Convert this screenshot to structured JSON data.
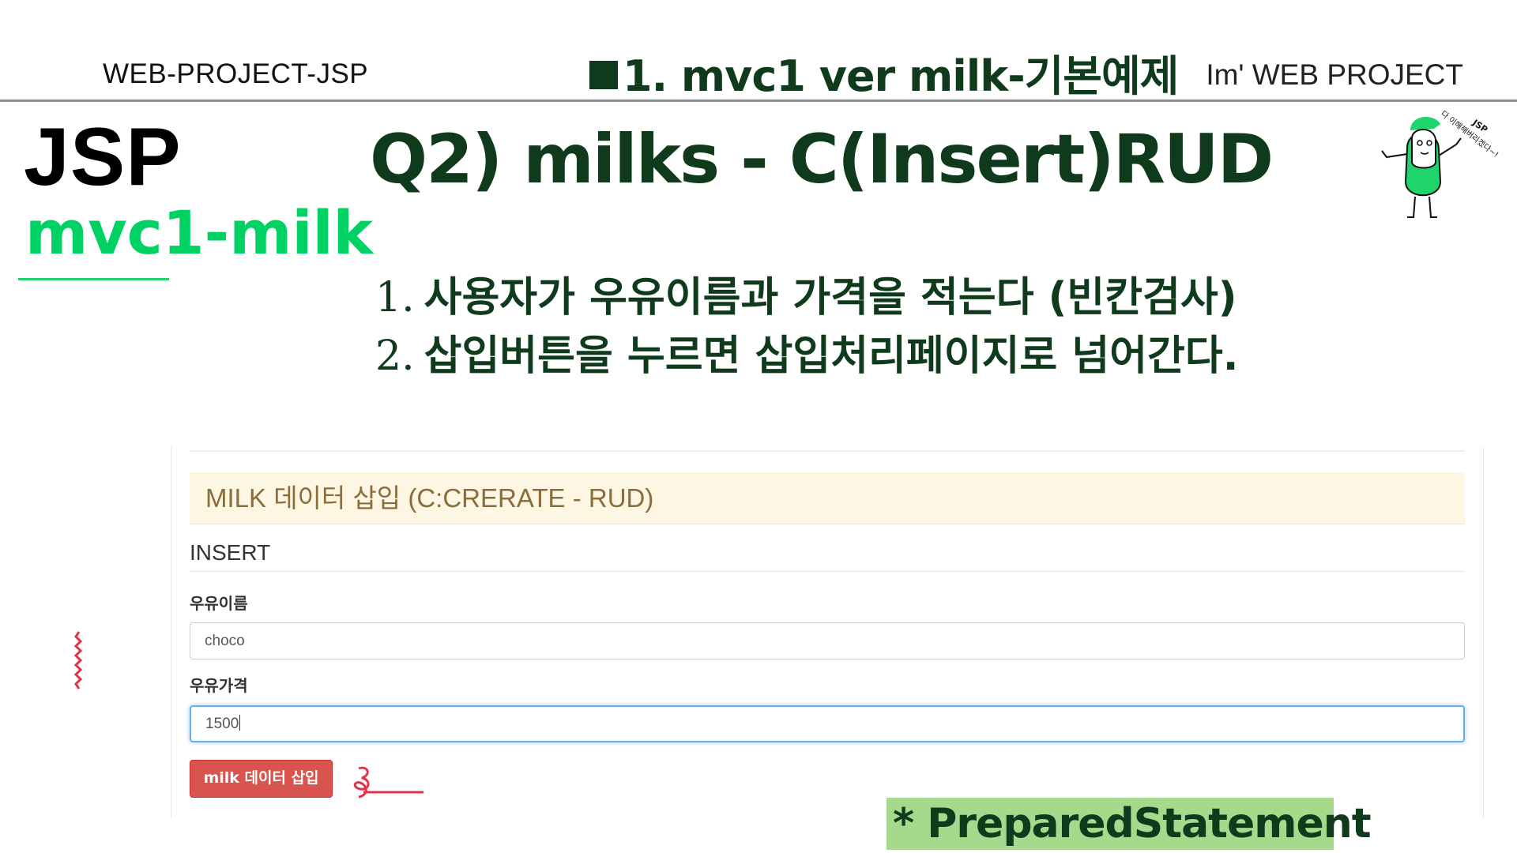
{
  "header": {
    "left": "WEB-PROJECT-JSP",
    "center": "1. mvc1 ver  milk-기본예제",
    "right": "Im'  WEB PROJECT"
  },
  "side": {
    "title": "JSP",
    "subtitle": "mvc1-milk"
  },
  "main": {
    "question": "Q2) milks - C(Insert)RUD",
    "steps": [
      {
        "num": "1.",
        "text": "사용자가 우유이름과 가격을 적는다 (빈칸검사)"
      },
      {
        "num": "2.",
        "text": "삽입버튼을 누르면 삽입처리페이지로 넘어간다."
      }
    ]
  },
  "mascot": {
    "top_text": "JSP",
    "arc_text": "다 이해해버리겠다~!"
  },
  "form": {
    "panel_heading": "MILK 데이터 삽입 (C:CRERATE - RUD)",
    "section_title": "INSERT",
    "name_label": "우유이름",
    "name_value": "choco",
    "price_label": "우유가격",
    "price_value": "1500",
    "submit_label": "milk 데이터 삽입"
  },
  "note": {
    "label": "* PreparedStatement"
  },
  "colors": {
    "dark_green": "#0f3b1c",
    "bright_green": "#00d163",
    "note_bg": "#a6d98b",
    "panel_bg": "#fcf6e3",
    "button_red": "#d9534f"
  }
}
